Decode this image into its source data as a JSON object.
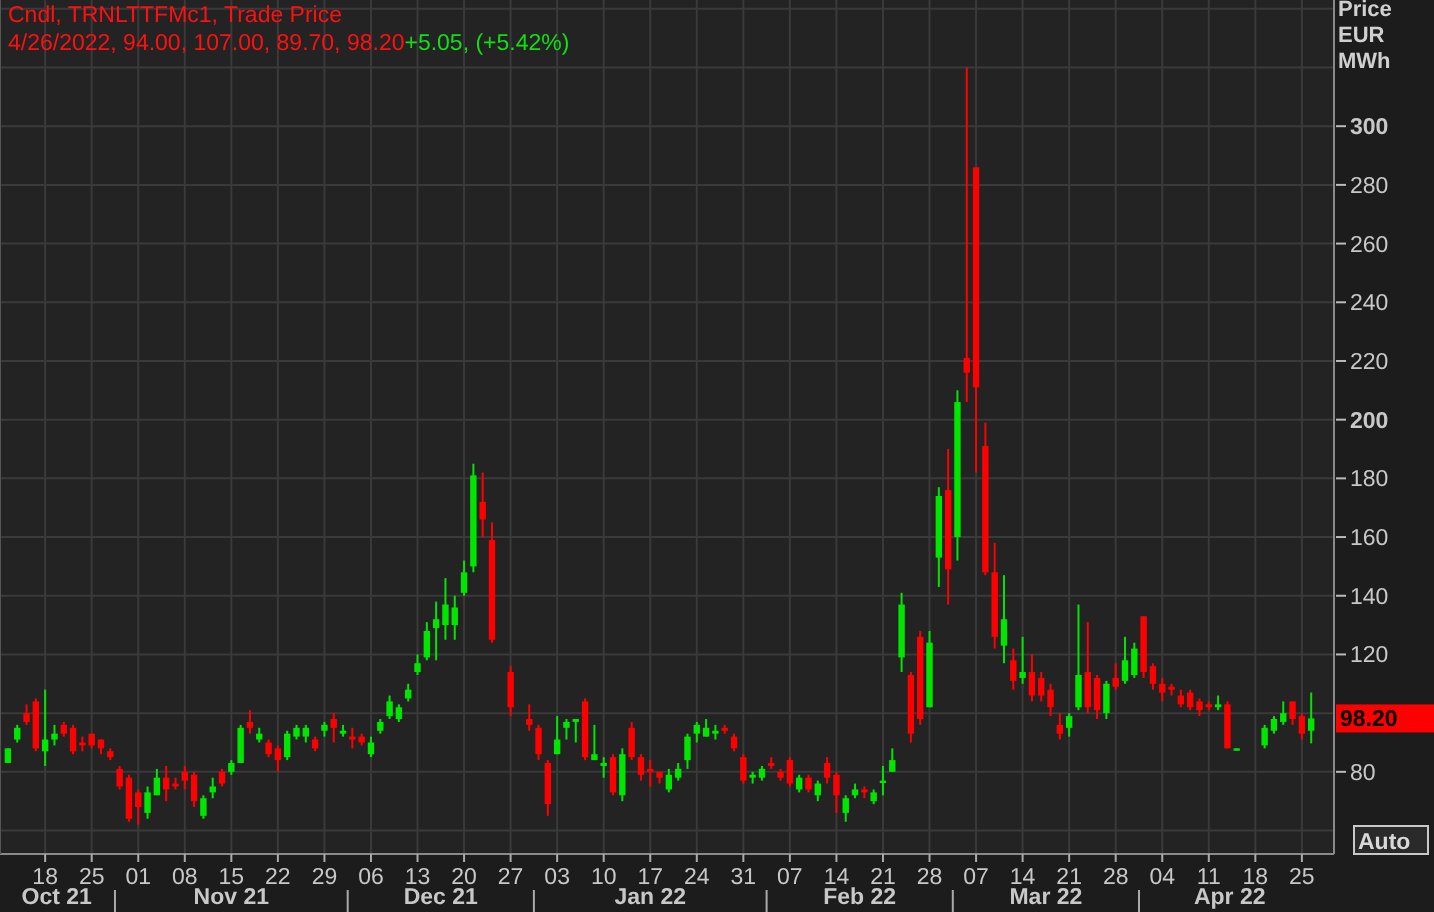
{
  "header": {
    "title": "Cndl, TRNLTTFMc1, Trade Price",
    "values": "4/26/2022, 94.00, 107.00, 89.70, 98.20",
    "change": "+5.05, (+5.42%)"
  },
  "axis_title": [
    "Price",
    "EUR",
    "MWh"
  ],
  "last_price": {
    "label": "98.20"
  },
  "auto_button": {
    "label": "Auto"
  },
  "month_axis": [
    "Oct 21",
    "Nov 21",
    "Dec 21",
    "Jan 22",
    "Feb 22",
    "Mar 22",
    "Apr 22"
  ],
  "chart_data": {
    "type": "candlestick",
    "ylim": [
      52,
      343
    ],
    "grid": true,
    "yticks": [
      80,
      120,
      140,
      160,
      180,
      200,
      220,
      240,
      260,
      280,
      300
    ],
    "categories": [
      null,
      null,
      null,
      null,
      "18",
      null,
      null,
      null,
      null,
      "25",
      null,
      null,
      null,
      null,
      "01",
      null,
      null,
      null,
      null,
      "08",
      null,
      null,
      null,
      null,
      "15",
      null,
      null,
      null,
      null,
      "22",
      null,
      null,
      null,
      null,
      "29",
      null,
      null,
      null,
      null,
      "06",
      null,
      null,
      null,
      null,
      "13",
      null,
      null,
      null,
      null,
      "20",
      null,
      null,
      null,
      null,
      "27",
      null,
      null,
      null,
      null,
      "03",
      null,
      null,
      null,
      null,
      "10",
      null,
      null,
      null,
      null,
      "17",
      null,
      null,
      null,
      null,
      "24",
      null,
      null,
      null,
      null,
      "31",
      null,
      null,
      null,
      null,
      "07",
      null,
      null,
      null,
      null,
      "14",
      null,
      null,
      null,
      null,
      "21",
      null,
      null,
      null,
      null,
      "28",
      null,
      null,
      null,
      null,
      "07",
      null,
      null,
      null,
      null,
      "14",
      null,
      null,
      null,
      null,
      "21",
      null,
      null,
      null,
      null,
      "28",
      null,
      null,
      null,
      null,
      "04",
      null,
      null,
      null,
      null,
      "11",
      null,
      null,
      null,
      null,
      "18",
      null,
      null,
      null,
      null,
      "25",
      null
    ],
    "ohlc": [
      [
        83,
        88,
        83,
        88
      ],
      [
        91,
        96,
        90,
        95
      ],
      [
        100,
        103,
        96,
        97
      ],
      [
        104,
        105,
        87,
        88
      ],
      [
        87,
        108,
        82,
        91
      ],
      [
        91,
        96,
        89,
        93
      ],
      [
        96,
        97,
        92,
        93
      ],
      [
        95,
        96,
        86,
        87
      ],
      [
        90,
        92,
        87,
        89
      ],
      [
        93,
        93,
        88,
        89
      ],
      [
        91,
        91,
        86,
        88
      ],
      [
        87,
        88,
        84,
        85
      ],
      [
        81,
        82,
        74,
        75
      ],
      [
        78,
        79,
        63,
        64
      ],
      [
        73,
        74,
        62,
        68
      ],
      [
        66,
        75,
        64,
        73
      ],
      [
        72,
        81,
        72,
        78
      ],
      [
        78,
        82,
        70,
        74
      ],
      [
        76,
        78,
        74,
        75
      ],
      [
        80,
        82,
        74,
        77
      ],
      [
        79,
        80,
        68,
        70
      ],
      [
        65,
        72,
        64,
        71
      ],
      [
        73,
        78,
        71,
        75
      ],
      [
        80,
        81,
        75,
        76
      ],
      [
        80,
        84,
        79,
        83
      ],
      [
        83,
        96,
        83,
        95
      ],
      [
        97,
        101,
        93,
        95
      ],
      [
        91,
        95,
        90,
        93
      ],
      [
        90,
        91,
        85,
        86
      ],
      [
        88,
        89,
        80,
        84
      ],
      [
        85,
        94,
        84,
        93
      ],
      [
        92,
        96,
        91,
        95
      ],
      [
        92,
        96,
        90,
        95
      ],
      [
        91,
        92,
        87,
        88
      ],
      [
        94,
        97,
        92,
        96
      ],
      [
        98,
        100,
        90,
        95
      ],
      [
        93,
        96,
        92,
        94
      ],
      [
        92,
        95,
        88,
        91
      ],
      [
        92,
        93,
        89,
        90
      ],
      [
        86,
        92,
        85,
        90
      ],
      [
        94,
        98,
        93,
        97
      ],
      [
        99,
        106,
        98,
        104
      ],
      [
        98,
        103,
        97,
        102
      ],
      [
        105,
        110,
        104,
        108
      ],
      [
        114,
        120,
        113,
        117
      ],
      [
        119,
        131,
        118,
        128
      ],
      [
        129,
        138,
        118,
        132
      ],
      [
        130,
        146,
        125,
        137
      ],
      [
        130,
        140,
        125,
        136
      ],
      [
        141,
        152,
        140,
        148
      ],
      [
        150,
        185,
        148,
        181
      ],
      [
        172,
        182,
        160,
        166
      ],
      [
        159,
        165,
        124,
        125
      ],
      null,
      [
        114,
        116,
        99,
        102
      ],
      null,
      [
        98,
        103,
        94,
        96
      ],
      [
        95,
        96,
        84,
        86
      ],
      [
        83,
        84,
        65,
        69
      ],
      [
        86,
        99,
        86,
        91
      ],
      [
        95,
        98,
        91,
        97
      ],
      [
        97,
        98,
        90,
        98
      ],
      [
        104,
        105,
        84,
        85
      ],
      [
        84,
        96,
        84,
        86
      ],
      [
        82,
        85,
        78,
        83
      ],
      [
        85,
        86,
        72,
        73
      ],
      [
        72,
        88,
        70,
        86
      ],
      [
        95,
        97,
        84,
        85
      ],
      [
        85,
        86,
        77,
        79
      ],
      [
        81,
        84,
        75,
        80
      ],
      [
        80,
        80,
        76,
        78
      ],
      [
        74,
        81,
        73,
        79
      ],
      [
        78,
        83,
        77,
        81
      ],
      [
        84,
        93,
        81,
        92
      ],
      [
        93,
        97,
        90,
        96
      ],
      [
        92,
        98,
        92,
        95
      ],
      [
        93,
        96,
        91,
        94
      ],
      [
        95,
        96,
        93,
        94
      ],
      [
        92,
        93,
        87,
        88
      ],
      [
        85,
        86,
        76,
        77
      ],
      [
        78,
        80,
        76,
        79
      ],
      [
        78,
        82,
        77,
        81
      ],
      [
        83,
        85,
        81,
        82
      ],
      [
        80,
        81,
        77,
        78
      ],
      [
        84,
        85,
        75,
        76
      ],
      [
        74,
        79,
        73,
        78
      ],
      [
        78,
        79,
        73,
        74
      ],
      [
        72,
        77,
        70,
        76
      ],
      [
        83,
        85,
        76,
        78
      ],
      [
        79,
        80,
        66,
        72
      ],
      [
        66,
        72,
        63,
        71
      ],
      [
        72,
        76,
        71,
        74
      ],
      [
        74,
        75,
        71,
        73
      ],
      [
        70,
        74,
        69,
        73
      ],
      [
        77,
        82,
        72,
        77
      ],
      [
        80,
        88,
        80,
        84
      ],
      [
        119,
        141,
        114,
        137
      ],
      [
        113,
        114,
        90,
        93
      ],
      [
        126,
        128,
        96,
        98
      ],
      [
        102,
        128,
        102,
        124
      ],
      [
        153,
        177,
        143,
        174
      ],
      [
        176,
        190,
        137,
        149
      ],
      [
        160,
        210,
        152,
        206
      ],
      [
        221,
        320,
        206,
        216
      ],
      [
        286,
        286,
        182,
        211
      ],
      [
        191,
        199,
        147,
        148
      ],
      [
        148,
        158,
        122,
        126
      ],
      [
        123,
        147,
        117,
        132
      ],
      [
        118,
        122,
        108,
        111
      ],
      [
        112,
        126,
        110,
        114
      ],
      [
        114,
        120,
        104,
        106
      ],
      [
        112,
        114,
        104,
        106
      ],
      [
        108,
        110,
        99,
        102
      ],
      [
        96,
        100,
        91,
        93
      ],
      [
        95,
        100,
        92,
        99
      ],
      [
        102,
        137,
        101,
        113
      ],
      [
        114,
        131,
        100,
        102
      ],
      [
        112,
        113,
        98,
        101
      ],
      [
        100,
        111,
        98,
        110
      ],
      [
        112,
        117,
        108,
        109
      ],
      [
        111,
        126,
        110,
        118
      ],
      [
        113,
        124,
        112,
        122
      ],
      [
        133,
        133,
        112,
        114
      ],
      [
        116,
        117,
        108,
        110
      ],
      [
        110,
        112,
        104,
        107
      ],
      [
        109,
        110,
        106,
        108
      ],
      [
        106,
        108,
        102,
        103
      ],
      [
        107,
        108,
        101,
        102
      ],
      [
        104,
        105,
        99,
        101
      ],
      [
        103,
        104,
        101,
        102
      ],
      [
        102,
        106,
        101,
        103
      ],
      [
        103,
        104,
        88,
        88
      ],
      [
        88,
        88,
        88,
        88
      ],
      null,
      null,
      [
        89,
        96,
        88,
        95
      ],
      [
        94,
        99,
        93,
        98
      ],
      [
        97,
        104,
        96,
        100
      ],
      [
        104,
        104,
        96,
        98
      ],
      [
        99,
        100,
        91,
        93
      ],
      [
        94,
        107,
        89.7,
        98.2
      ]
    ]
  }
}
